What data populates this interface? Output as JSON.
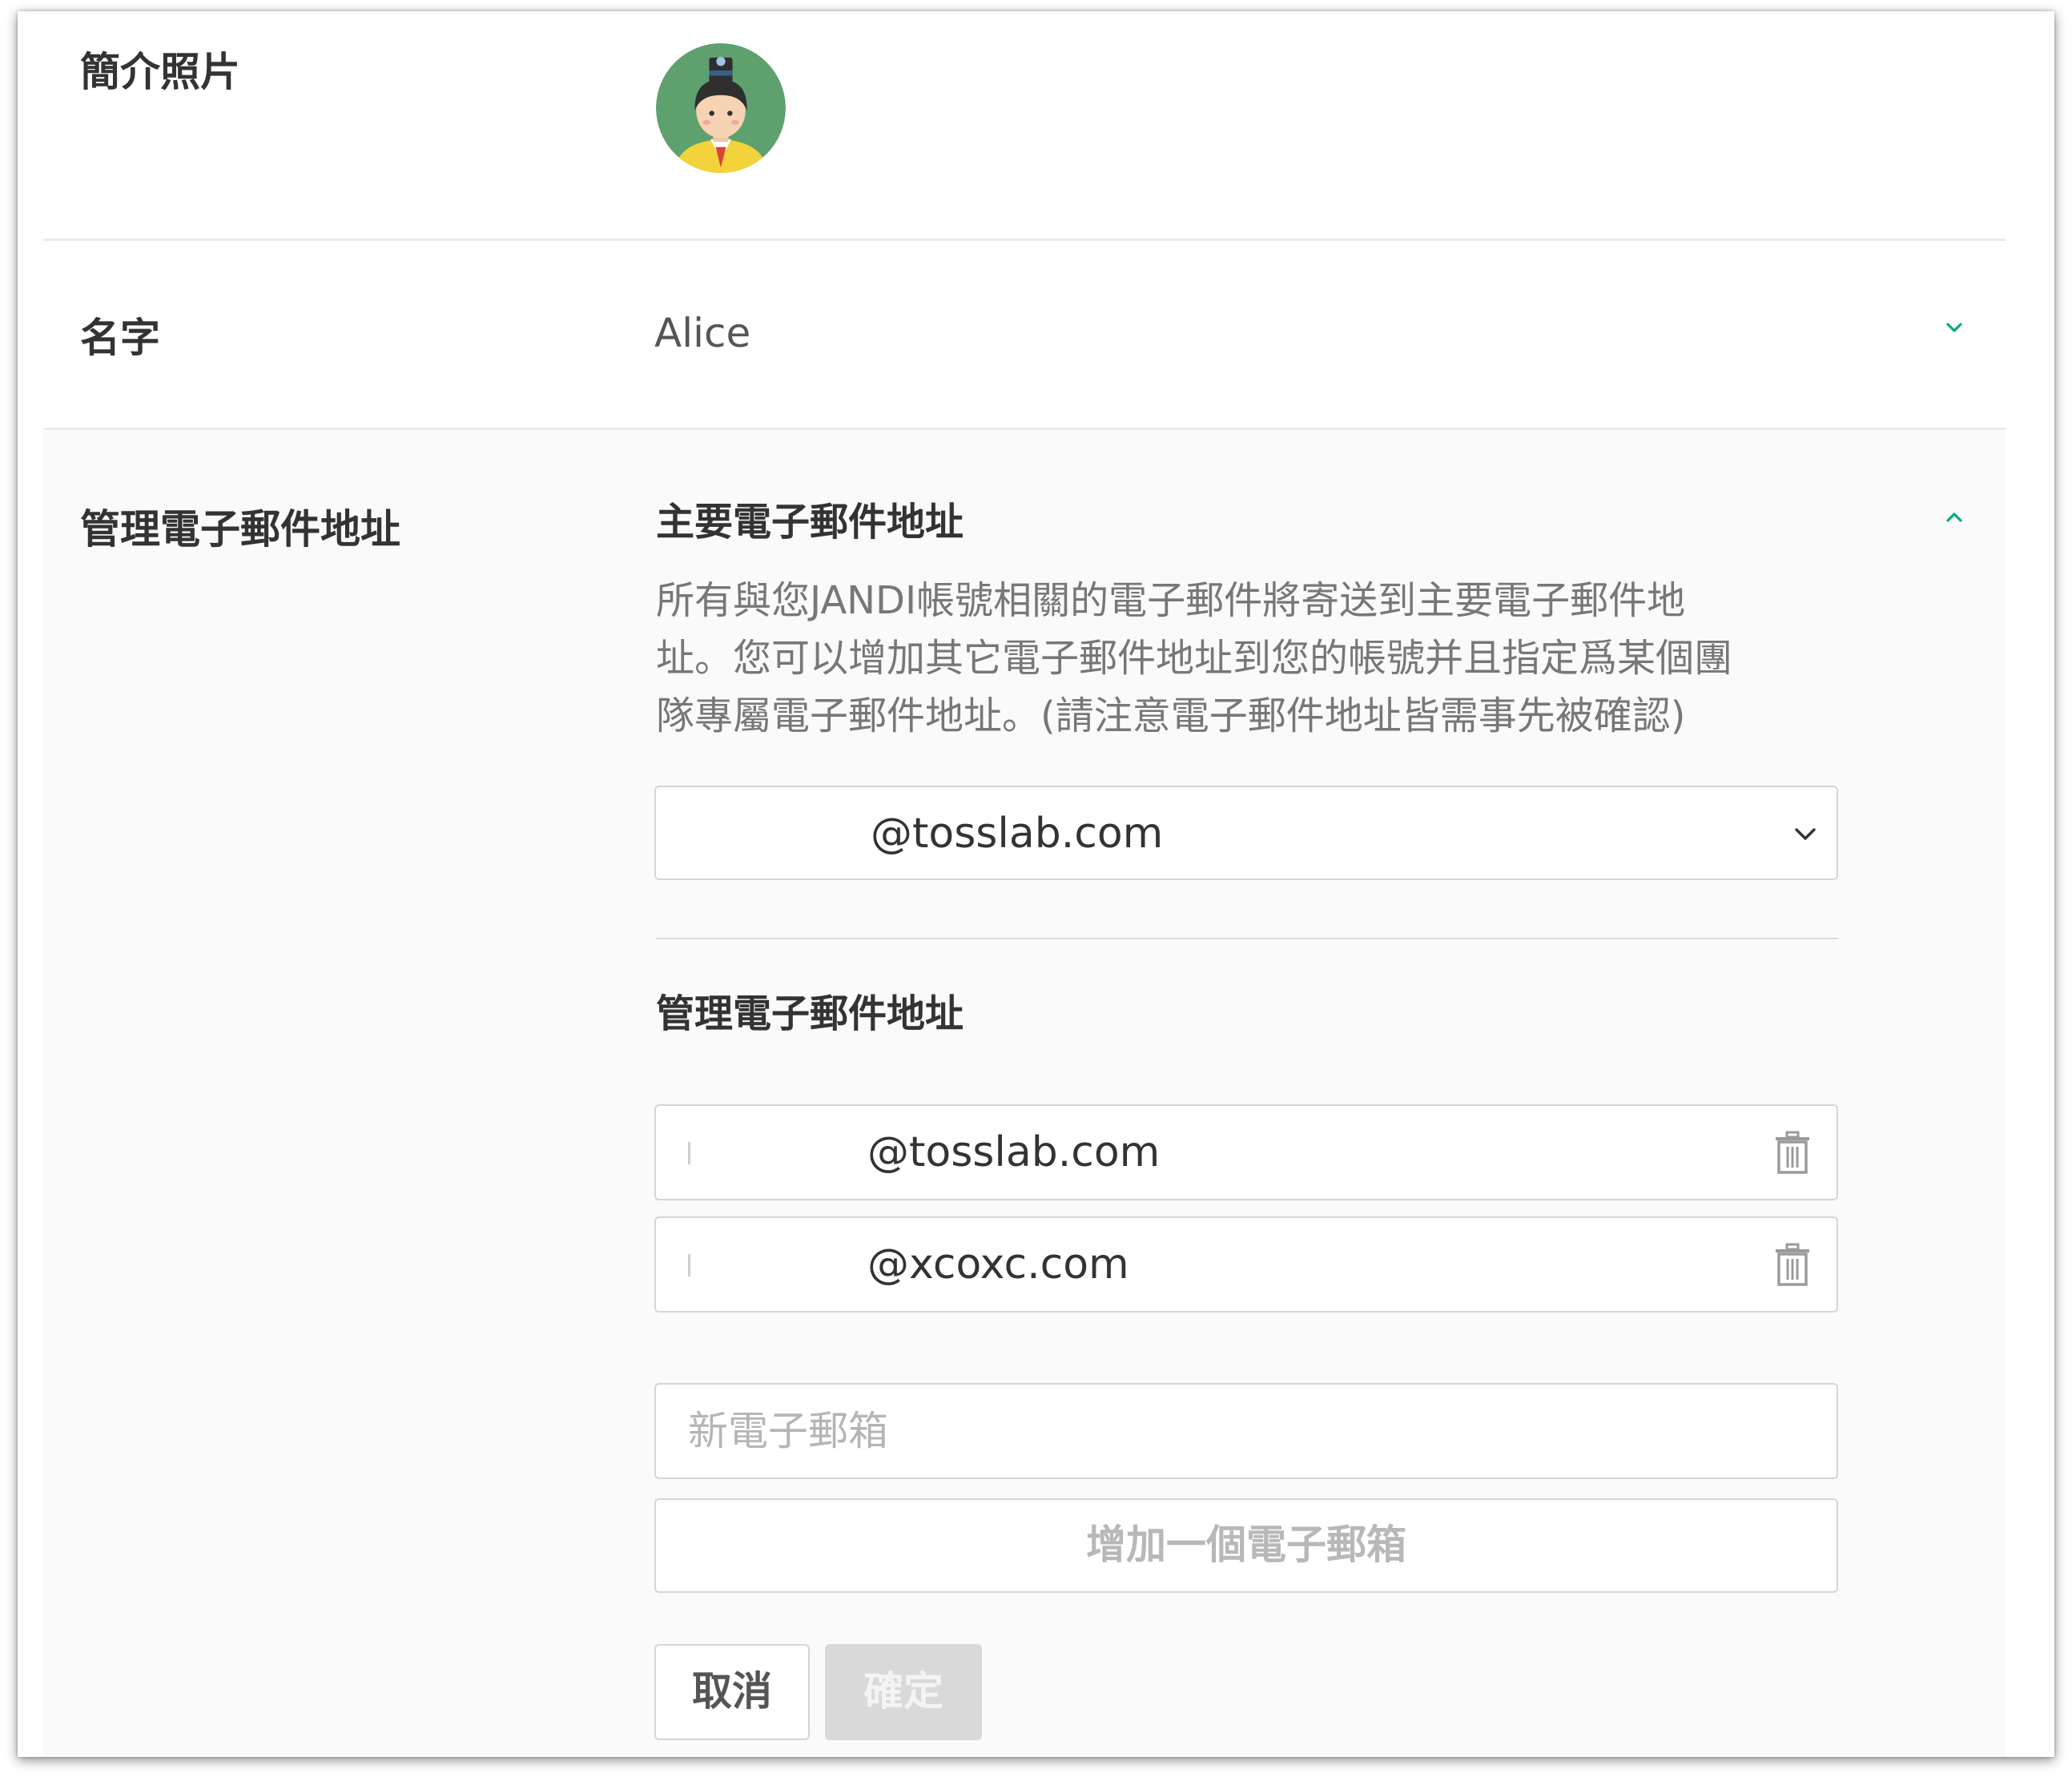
{
  "profile_photo": {
    "label": "簡介照片"
  },
  "name": {
    "label": "名字",
    "value": "Alice"
  },
  "email_management": {
    "label": "管理電子郵件地址",
    "primary": {
      "title": "主要電子郵件地址",
      "description_lines": [
        "所有與您JANDI帳號相關的電子郵件將寄送到主要電子郵件地",
        "址。您可以增加其它電子郵件地址到您的帳號并且指定爲某個團",
        "隊專屬電子郵件地址。(請注意電子郵件地址皆需事先被確認)"
      ],
      "selected_email": "@tosslab.com"
    },
    "manage": {
      "title": "管理電子郵件地址",
      "emails": [
        "@tosslab.com",
        "@xcoxc.com"
      ],
      "new_email_placeholder": "新電子郵箱",
      "add_button": "增加一個電子郵箱"
    },
    "cancel_button": "取消",
    "confirm_button": "確定"
  },
  "colors": {
    "accent": "#00ab84",
    "divider": "#ebebeb"
  },
  "icons": {
    "name_toggle": "chevron-down-icon",
    "email_toggle": "chevron-up-icon",
    "select_arrow": "chevron-down-icon",
    "delete": "trash-icon"
  }
}
